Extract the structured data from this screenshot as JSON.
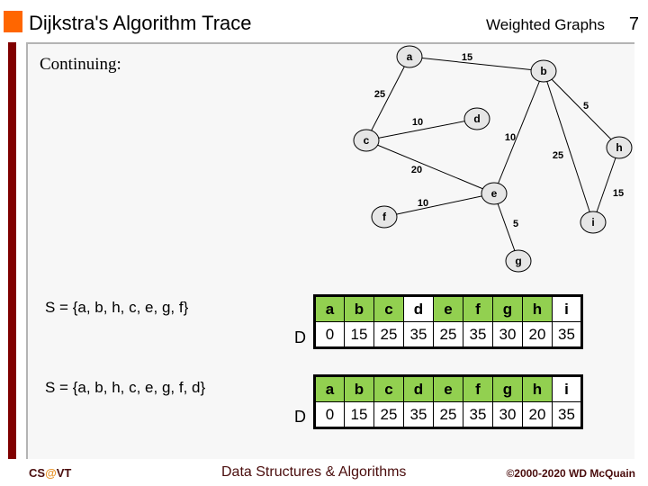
{
  "header": {
    "title": "Dijkstra's Algorithm Trace",
    "section": "Weighted Graphs",
    "page_number": "7",
    "accent_color": "#ff6600",
    "bar_color": "#800000"
  },
  "body": {
    "intro": "Continuing:"
  },
  "graph": {
    "nodes": [
      {
        "id": "a",
        "label": "a"
      },
      {
        "id": "b",
        "label": "b"
      },
      {
        "id": "c",
        "label": "c"
      },
      {
        "id": "d",
        "label": "d"
      },
      {
        "id": "e",
        "label": "e"
      },
      {
        "id": "f",
        "label": "f"
      },
      {
        "id": "g",
        "label": "g"
      },
      {
        "id": "h",
        "label": "h"
      },
      {
        "id": "i",
        "label": "i"
      }
    ],
    "edges": [
      {
        "from": "a",
        "to": "b",
        "weight": "15"
      },
      {
        "from": "a",
        "to": "c",
        "weight": "25"
      },
      {
        "from": "b",
        "to": "h",
        "weight": "5"
      },
      {
        "from": "b",
        "to": "e",
        "weight": "10"
      },
      {
        "from": "b",
        "to": "i",
        "weight": "25"
      },
      {
        "from": "c",
        "to": "d",
        "weight": "10"
      },
      {
        "from": "c",
        "to": "e",
        "weight": "20"
      },
      {
        "from": "e",
        "to": "f",
        "weight": "10"
      },
      {
        "from": "e",
        "to": "g",
        "weight": "5"
      },
      {
        "from": "h",
        "to": "i",
        "weight": "15"
      }
    ]
  },
  "traces": [
    {
      "set_label": "S = {a, b, h, c, e, g, f}",
      "row_label": "D",
      "vertices": [
        "a",
        "b",
        "c",
        "d",
        "e",
        "f",
        "g",
        "h",
        "i"
      ],
      "in_set": [
        true,
        true,
        true,
        false,
        true,
        true,
        true,
        true,
        false
      ],
      "distances": [
        "0",
        "15",
        "25",
        "35",
        "25",
        "35",
        "30",
        "20",
        "35"
      ]
    },
    {
      "set_label": "S = {a, b, h, c, e, g, f, d}",
      "row_label": "D",
      "vertices": [
        "a",
        "b",
        "c",
        "d",
        "e",
        "f",
        "g",
        "h",
        "i"
      ],
      "in_set": [
        true,
        true,
        true,
        true,
        true,
        true,
        true,
        true,
        false
      ],
      "distances": [
        "0",
        "15",
        "25",
        "35",
        "25",
        "35",
        "30",
        "20",
        "35"
      ]
    }
  ],
  "colors": {
    "in_set_fill": "#92d050",
    "node_fill": "#e6e6e6"
  },
  "footer": {
    "left_cs": "CS",
    "left_at": "@",
    "left_vt": "VT",
    "center": "Data Structures & Algorithms",
    "right": "©2000-2020 WD McQuain"
  }
}
